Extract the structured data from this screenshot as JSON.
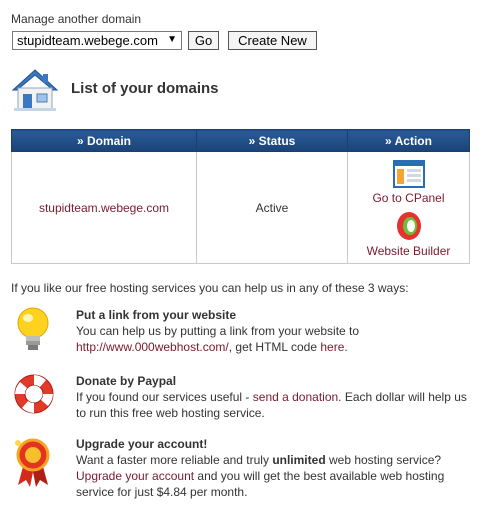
{
  "manage": {
    "label": "Manage another domain",
    "selected_domain": "stupidteam.webege.com",
    "go_label": "Go",
    "create_label": "Create New"
  },
  "heading": "List of your domains",
  "table": {
    "headers": [
      "» Domain",
      "» Status",
      "» Action"
    ],
    "rows": [
      {
        "domain": "stupidteam.webege.com",
        "status": "Active",
        "actions": [
          "Go to CPanel",
          "Website Builder"
        ]
      }
    ]
  },
  "help": {
    "intro": "If you like our free hosting services you can help us in any of these 3 ways:",
    "ways": [
      {
        "icon": "lightbulb-icon",
        "title": "Put a link from your website",
        "text_1": "You can help us by putting a link from your website to",
        "link_1": "http://www.000webhost.com/",
        "text_2": ", get HTML code ",
        "link_2": "here",
        "text_3": "."
      },
      {
        "icon": "lifebuoy-icon",
        "title": "Donate by Paypal",
        "text_1": "If you found our services useful - ",
        "link_1": "send a donation",
        "text_2": ". Each dollar will help us to run this free web hosting service."
      },
      {
        "icon": "ribbon-icon",
        "title": "Upgrade your account!",
        "text_1": "Want a faster more reliable and truly ",
        "bold_1": "unlimited",
        "text_2": " web hosting service? ",
        "link_1": "Upgrade your account",
        "text_3": " and you will get the best available web hosting service for just $4.84 per month."
      }
    ]
  }
}
